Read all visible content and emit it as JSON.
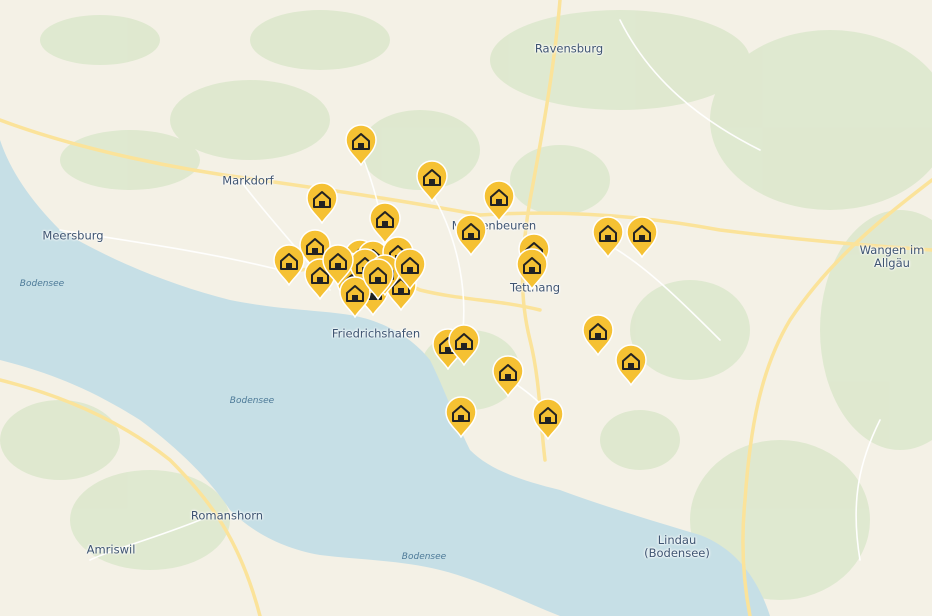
{
  "map": {
    "colors": {
      "land": "#f4f1e6",
      "water": "#c6dfe6",
      "forest": "#dde8cd",
      "road_major": "#fbe39a",
      "road_minor": "#ffffff",
      "marker": "#f5c133",
      "marker_icon": "#222222"
    },
    "places": [
      {
        "id": "ravensburg",
        "name": "Ravensburg"
      },
      {
        "id": "markdorf",
        "name": "Markdorf"
      },
      {
        "id": "meersburg",
        "name": "Meersburg"
      },
      {
        "id": "meckenbeuren",
        "name": "Meckenbeuren"
      },
      {
        "id": "tettnang",
        "name": "Tettnang"
      },
      {
        "id": "friedrichshafen",
        "name": "Friedrichshafen"
      },
      {
        "id": "wangen",
        "name": "Wangen im Allgäu"
      },
      {
        "id": "romanshorn",
        "name": "Romanshorn"
      },
      {
        "id": "amriswil",
        "name": "Amriswil"
      },
      {
        "id": "lindau",
        "name": "Lindau (Bodensee)"
      }
    ],
    "water_labels": [
      "Bodensee",
      "Bodensee",
      "Bodensee"
    ],
    "marker_icon": "house-icon",
    "marker_count": 33
  }
}
